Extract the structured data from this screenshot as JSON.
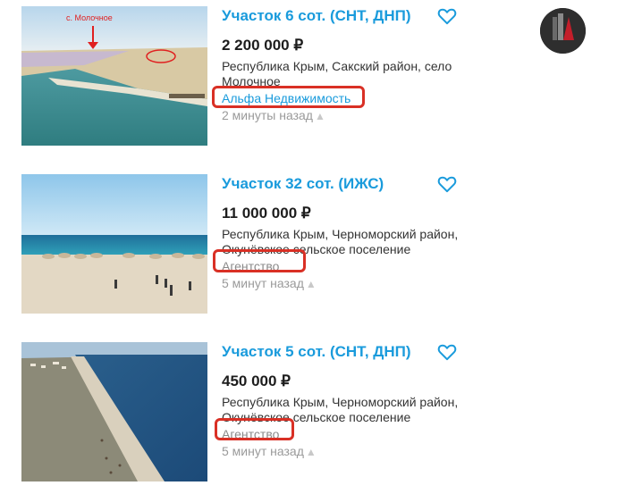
{
  "listings": [
    {
      "title": "Участок 6 сот. (СНТ, ДНП)",
      "price": "2 200 000 ₽",
      "address": "Республика Крым, Сакский район, село Молочное",
      "seller": "Альфа Недвижимость",
      "posted": "2 минуты назад",
      "photo_caption": "с. Молочное"
    },
    {
      "title": "Участок 32 сот. (ИЖС)",
      "price": "11 000 000 ₽",
      "address": "Республика Крым, Черноморский район, Окунёвское сельское поселение",
      "seller": "Агентство",
      "posted": "5 минут назад"
    },
    {
      "title": "Участок 5 сот. (СНТ, ДНП)",
      "price": "450 000 ₽",
      "address": "Республика Крым, Черноморский район, Окунёвское сельское поселение",
      "seller": "Агентство",
      "posted": "5 минут назад"
    }
  ],
  "icons": {
    "favorite": "heart-outline-icon",
    "raise": "arrow-up-icon"
  },
  "colors": {
    "link": "#1a9bdc",
    "highlight": "#d93025"
  }
}
